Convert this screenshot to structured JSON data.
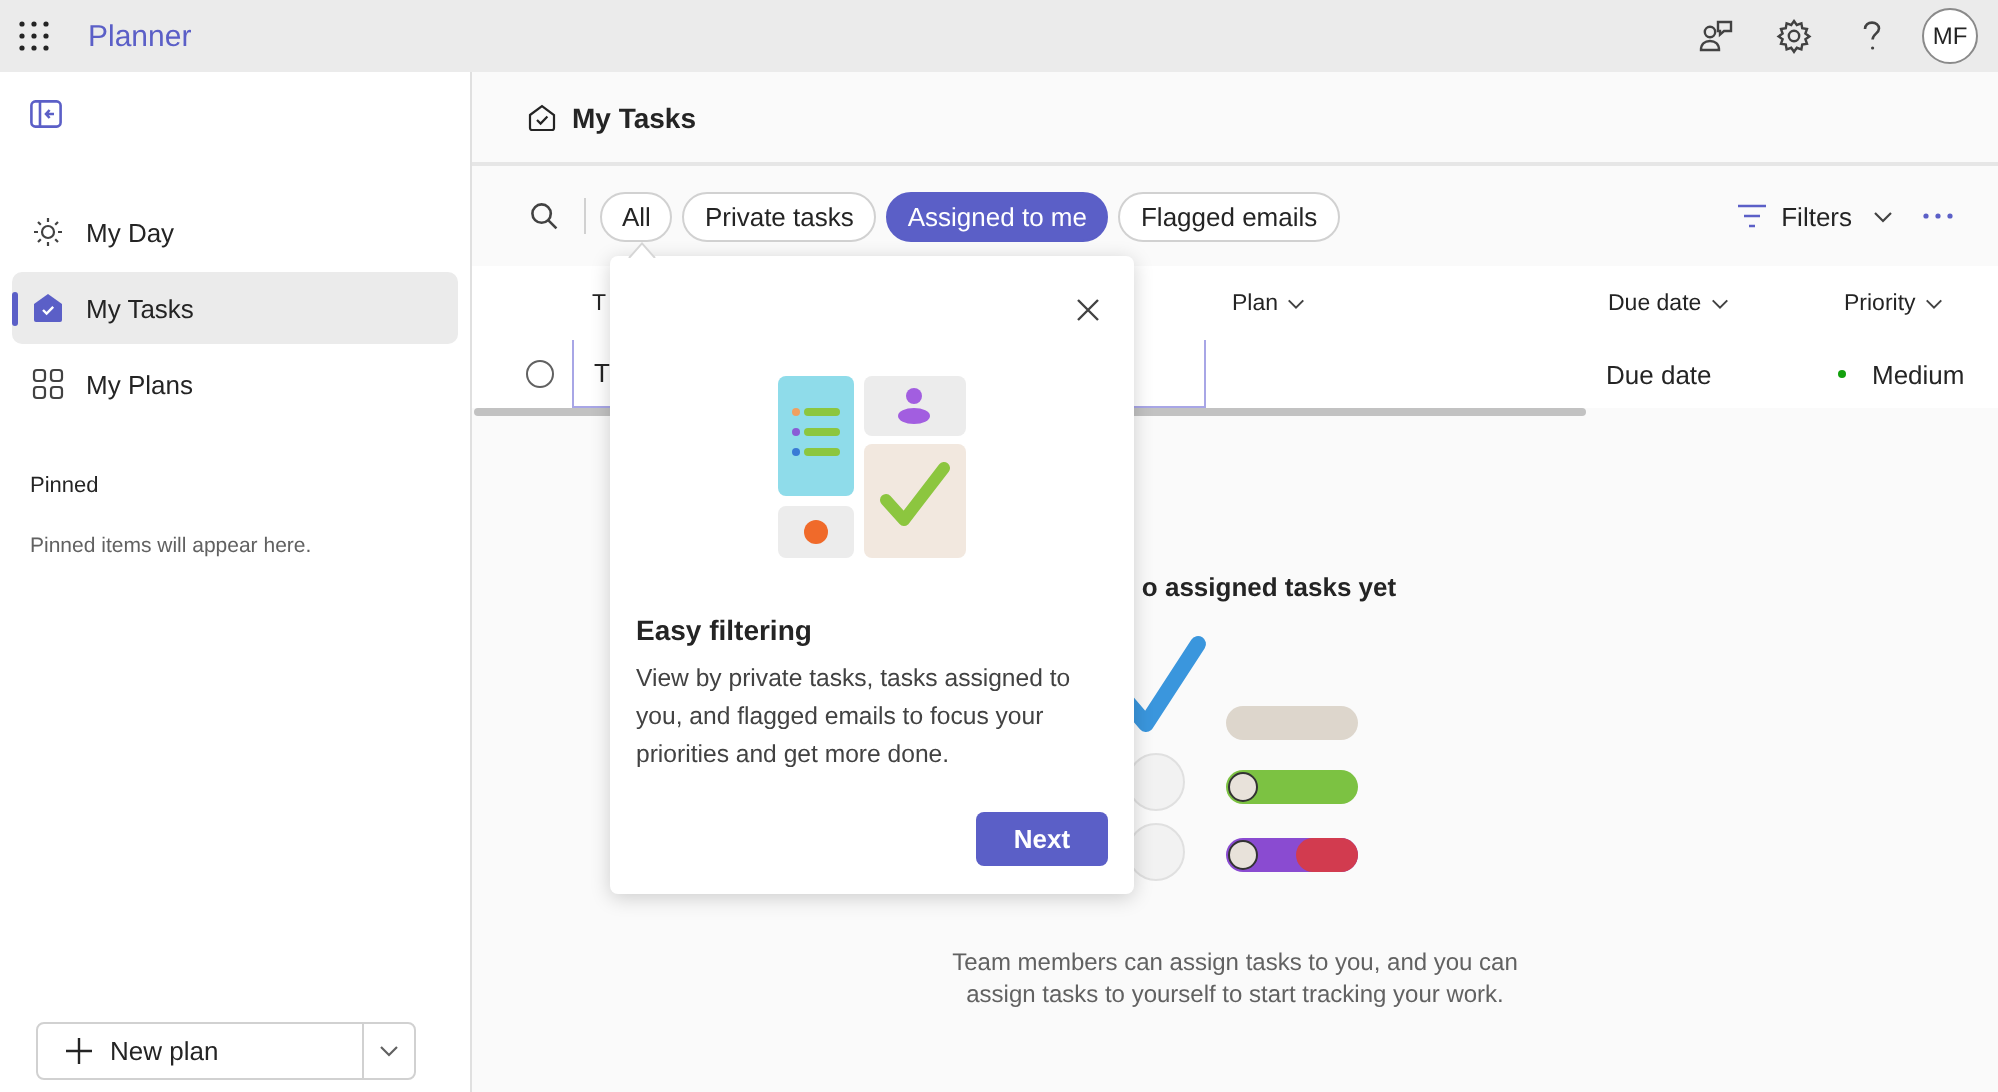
{
  "app": {
    "title": "Planner",
    "avatar": "MF"
  },
  "sidebar": {
    "items": [
      {
        "label": "My Day",
        "selected": false
      },
      {
        "label": "My Tasks",
        "selected": true
      },
      {
        "label": "My Plans",
        "selected": false
      }
    ],
    "pinned_heading": "Pinned",
    "pinned_empty": "Pinned items will appear here.",
    "new_plan_button": "New plan"
  },
  "page": {
    "title": "My Tasks"
  },
  "filters": [
    {
      "label": "All",
      "selected": false
    },
    {
      "label": "Private tasks",
      "selected": false
    },
    {
      "label": "Assigned to me",
      "selected": true
    },
    {
      "label": "Flagged emails",
      "selected": false
    }
  ],
  "filters_button": "Filters",
  "table": {
    "columns": [
      {
        "label": "T",
        "sortable": false
      },
      {
        "label": "Plan",
        "sortable": true
      },
      {
        "label": "Due date",
        "sortable": true
      },
      {
        "label": "Priority",
        "sortable": true
      }
    ],
    "rows": [
      {
        "checked": false,
        "title": "T",
        "due_date": "Due date",
        "priority": "Medium"
      }
    ]
  },
  "popover": {
    "title": "Easy filtering",
    "body": "View by private tasks, tasks assigned to you, and flagged emails to focus your priorities and get more done.",
    "button": "Next"
  },
  "empty_state": {
    "title": "o assigned tasks yet",
    "body": "Team members can assign tasks to you, and you can assign tasks to yourself to start tracking your work."
  }
}
